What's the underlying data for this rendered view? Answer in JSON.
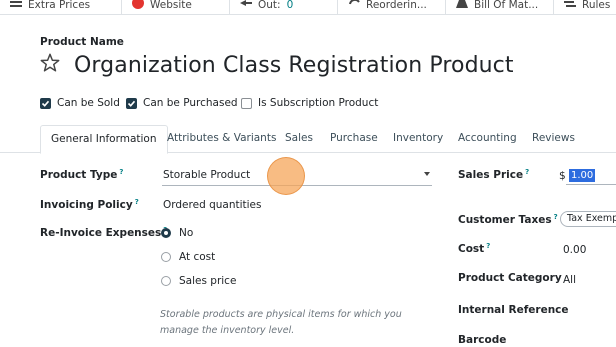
{
  "smart_buttons": [
    {
      "label": "Extra Prices",
      "icon": "list-icon"
    },
    {
      "label": "Website",
      "icon": "globe-icon"
    },
    {
      "label": "Out:",
      "value": "0",
      "icon": "arrow-left-icon"
    },
    {
      "label": "Reorderin...",
      "icon": "refresh-icon"
    },
    {
      "label": "Bill Of Mat...",
      "icon": "flask-icon"
    },
    {
      "label": "Rules",
      "icon": "rules-icon"
    }
  ],
  "product": {
    "name_label": "Product Name",
    "name": "Organization Class Registration Product"
  },
  "checkboxes": [
    {
      "label": "Can be Sold",
      "checked": true
    },
    {
      "label": "Can be Purchased",
      "checked": true
    },
    {
      "label": "Is Subscription Product",
      "checked": false
    }
  ],
  "tabs": [
    "General Information",
    "Attributes & Variants",
    "Sales",
    "Purchase",
    "Inventory",
    "Accounting",
    "Reviews"
  ],
  "left_fields": {
    "product_type": {
      "label": "Product Type",
      "value": "Storable Product"
    },
    "invoicing_policy": {
      "label": "Invoicing Policy",
      "value": "Ordered quantities"
    },
    "reinvoice": {
      "label": "Re-Invoice Expenses",
      "options": [
        "No",
        "At cost",
        "Sales price"
      ],
      "selected": "No"
    },
    "help_text": "Storable products are physical items for which you manage the inventory level."
  },
  "right_fields": {
    "sales_price": {
      "label": "Sales Price",
      "currency": "$",
      "value": "1.00"
    },
    "customer_taxes": {
      "label": "Customer Taxes",
      "value": "Tax Exempt"
    },
    "cost": {
      "label": "Cost",
      "value": "0.00"
    },
    "product_category": {
      "label": "Product Category",
      "value": "All"
    },
    "internal_reference": {
      "label": "Internal Reference"
    },
    "barcode": {
      "label": "Barcode"
    }
  },
  "help_marker": "?",
  "colors": {
    "accent": "#017e84",
    "checkbox": "#1f3a4a",
    "cursor": "#f5a65a",
    "selection": "#2d6cdf"
  }
}
